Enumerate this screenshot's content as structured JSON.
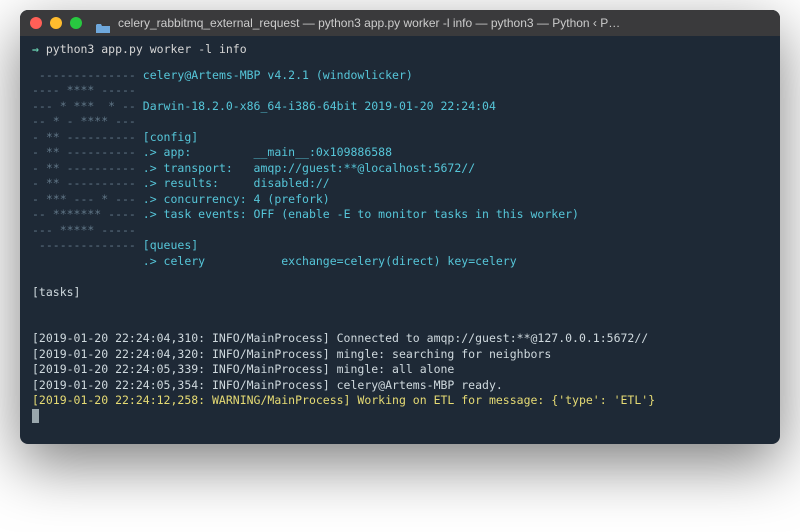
{
  "titlebar": {
    "title": "celery_rabbitmq_external_request — python3 app.py worker -l info — python3 — Python ‹ P…"
  },
  "prompt": {
    "arrow": "⇒",
    "command": "python3 app.py worker -l info"
  },
  "banner": {
    "l1_dash": " -------------- ",
    "l1_text": "celery@Artems-MBP v4.2.1 (windowlicker)",
    "l2": "---- **** -----",
    "l3_dash": "--- * ***  * -- ",
    "l3_text": "Darwin-18.2.0-x86_64-i386-64bit 2019-01-20 22:24:04",
    "l4": "-- * - **** ---",
    "l5_dash": "- ** ---------- ",
    "l5_text": "[config]",
    "l6_dash": "- ** ---------- ",
    "l6_text": ".> app:         __main__:0x109886588",
    "l7_dash": "- ** ---------- ",
    "l7_text": ".> transport:   amqp://guest:**@localhost:5672//",
    "l8_dash": "- ** ---------- ",
    "l8_text": ".> results:     disabled://",
    "l9_dash": "- *** --- * --- ",
    "l9_text": ".> concurrency: 4 (prefork)",
    "l10_dash": "-- ******* ---- ",
    "l10_text": ".> task events: OFF (enable -E to monitor tasks in this worker)",
    "l11": "--- ***** -----",
    "l12_dash": " -------------- ",
    "l12_text": "[queues]",
    "l13_dash": "                ",
    "l13_text": ".> celery           exchange=celery(direct) key=celery"
  },
  "tasks_header": "[tasks]",
  "logs": {
    "l1": "[2019-01-20 22:24:04,310: INFO/MainProcess] Connected to amqp://guest:**@127.0.0.1:5672//",
    "l2": "[2019-01-20 22:24:04,320: INFO/MainProcess] mingle: searching for neighbors",
    "l3": "[2019-01-20 22:24:05,339: INFO/MainProcess] mingle: all alone",
    "l4": "[2019-01-20 22:24:05,354: INFO/MainProcess] celery@Artems-MBP ready.",
    "l5": "[2019-01-20 22:24:12,258: WARNING/MainProcess] Working on ETL for message: {'type': 'ETL'}"
  }
}
